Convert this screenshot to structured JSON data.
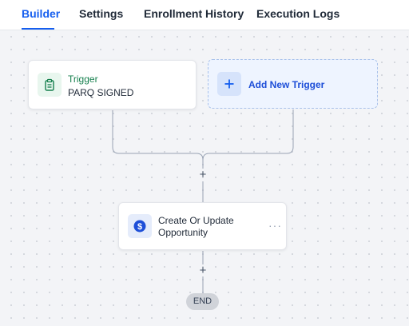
{
  "tabs": [
    {
      "label": "Builder",
      "active": true
    },
    {
      "label": "Settings",
      "active": false
    },
    {
      "label": "Enrollment History",
      "active": false
    },
    {
      "label": "Execution Logs",
      "active": false
    }
  ],
  "trigger_card": {
    "label": "Trigger",
    "value": "PARQ SIGNED",
    "icon": "clipboard-icon"
  },
  "add_trigger": {
    "label": "Add New Trigger",
    "icon": "plus-icon"
  },
  "action_card": {
    "label": "Create Or Update Opportunity",
    "icon": "dollar-icon",
    "menu": "···"
  },
  "add_step_symbol": "+",
  "end_label": "END",
  "colors": {
    "accent": "#155eef",
    "trigger_green": "#157f4d",
    "add_trigger_bg": "#eef4ff"
  }
}
